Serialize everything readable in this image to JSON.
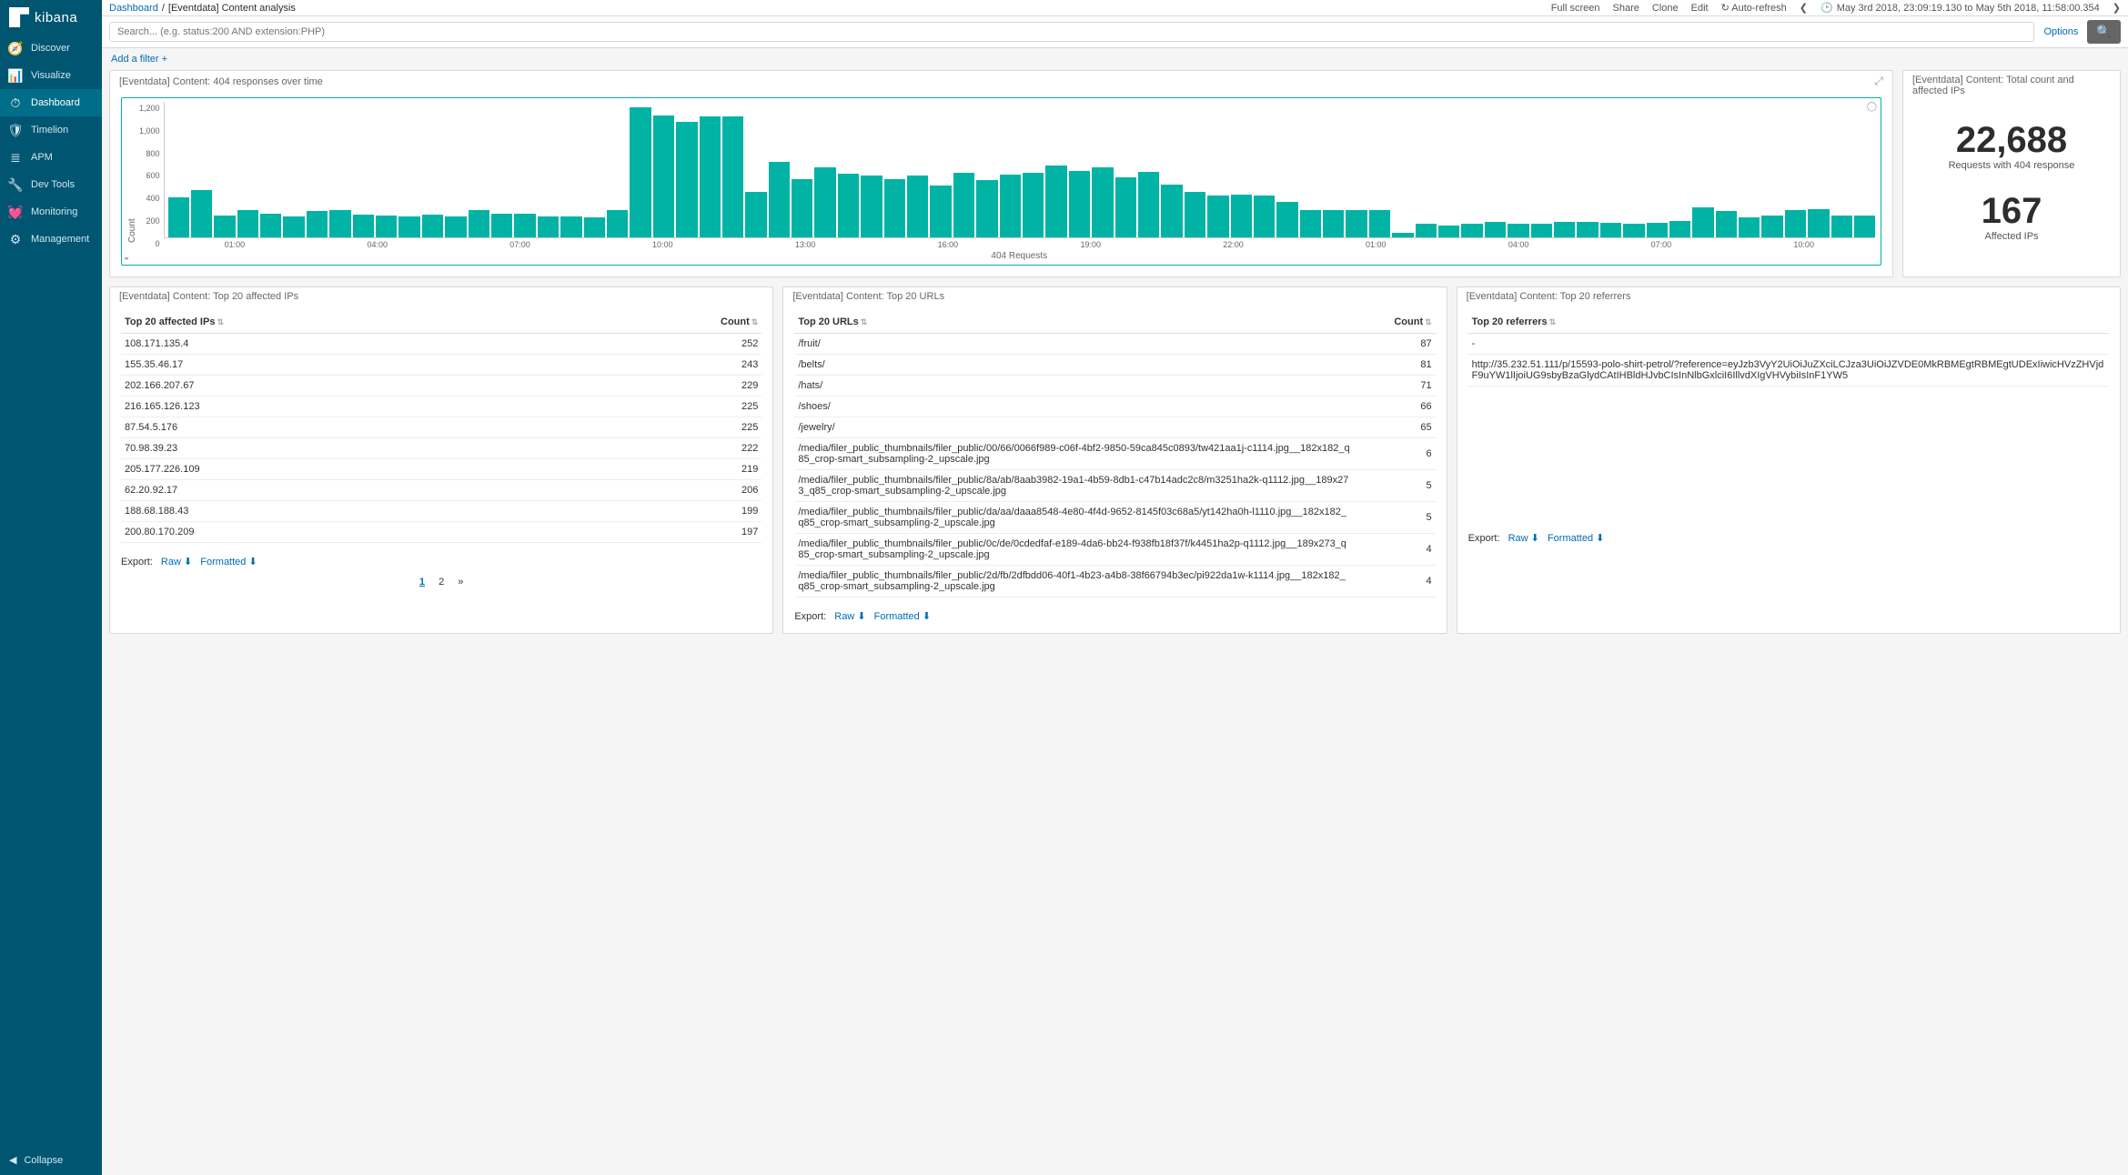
{
  "app": {
    "name": "kibana",
    "collapse_label": "Collapse"
  },
  "nav": {
    "items": [
      {
        "label": "Discover",
        "icon": "compass"
      },
      {
        "label": "Visualize",
        "icon": "bar-chart"
      },
      {
        "label": "Dashboard",
        "icon": "gauge",
        "active": true
      },
      {
        "label": "Timelion",
        "icon": "shield"
      },
      {
        "label": "APM",
        "icon": "list"
      },
      {
        "label": "Dev Tools",
        "icon": "wrench"
      },
      {
        "label": "Monitoring",
        "icon": "heartbeat"
      },
      {
        "label": "Management",
        "icon": "gear"
      }
    ]
  },
  "breadcrumb": {
    "root": "Dashboard",
    "sep": "/",
    "current": "[Eventdata] Content analysis"
  },
  "topbar": {
    "full_screen": "Full screen",
    "share": "Share",
    "clone": "Clone",
    "edit": "Edit",
    "auto_refresh": "Auto-refresh",
    "time_range": "May 3rd 2018, 23:09:19.130 to May 5th 2018, 11:58:00.354"
  },
  "search": {
    "placeholder": "Search... (e.g. status:200 AND extension:PHP)",
    "options_label": "Options"
  },
  "filter": {
    "add_label": "Add a filter"
  },
  "panels": {
    "chart_title": "[Eventdata] Content: 404 responses over time",
    "metrics_title": "[Eventdata] Content: Total count and affected IPs",
    "ips_title": "[Eventdata] Content: Top 20 affected IPs",
    "urls_title": "[Eventdata] Content: Top 20 URLs",
    "referrers_title": "[Eventdata] Content: Top 20 referrers"
  },
  "metrics": {
    "requests_value": "22,688",
    "requests_label": "Requests with 404 response",
    "ips_value": "167",
    "ips_label": "Affected IPs"
  },
  "export": {
    "label": "Export:",
    "raw": "Raw",
    "formatted": "Formatted"
  },
  "pagination": {
    "p1": "1",
    "p2": "2",
    "next": "»"
  },
  "ips_table": {
    "col_ip": "Top 20 affected IPs",
    "col_count": "Count",
    "rows": [
      {
        "ip": "108.171.135.4",
        "count": "252"
      },
      {
        "ip": "155.35.46.17",
        "count": "243"
      },
      {
        "ip": "202.166.207.67",
        "count": "229"
      },
      {
        "ip": "216.165.126.123",
        "count": "225"
      },
      {
        "ip": "87.54.5.176",
        "count": "225"
      },
      {
        "ip": "70.98.39.23",
        "count": "222"
      },
      {
        "ip": "205.177.226.109",
        "count": "219"
      },
      {
        "ip": "62.20.92.17",
        "count": "206"
      },
      {
        "ip": "188.68.188.43",
        "count": "199"
      },
      {
        "ip": "200.80.170.209",
        "count": "197"
      }
    ]
  },
  "urls_table": {
    "col_url": "Top 20 URLs",
    "col_count": "Count",
    "rows": [
      {
        "url": "/fruit/",
        "count": "87"
      },
      {
        "url": "/belts/",
        "count": "81"
      },
      {
        "url": "/hats/",
        "count": "71"
      },
      {
        "url": "/shoes/",
        "count": "66"
      },
      {
        "url": "/jewelry/",
        "count": "65"
      },
      {
        "url": "/media/filer_public_thumbnails/filer_public/00/66/0066f989-c06f-4bf2-9850-59ca845c0893/tw421aa1j-c1114.jpg__182x182_q85_crop-smart_subsampling-2_upscale.jpg",
        "count": "6"
      },
      {
        "url": "/media/filer_public_thumbnails/filer_public/8a/ab/8aab3982-19a1-4b59-8db1-c47b14adc2c8/m3251ha2k-q1112.jpg__189x273_q85_crop-smart_subsampling-2_upscale.jpg",
        "count": "5"
      },
      {
        "url": "/media/filer_public_thumbnails/filer_public/da/aa/daaa8548-4e80-4f4d-9652-8145f03c68a5/yt142ha0h-l1110.jpg__182x182_q85_crop-smart_subsampling-2_upscale.jpg",
        "count": "5"
      },
      {
        "url": "/media/filer_public_thumbnails/filer_public/0c/de/0cdedfaf-e189-4da6-bb24-f938fb18f37f/k4451ha2p-q1112.jpg__189x273_q85_crop-smart_subsampling-2_upscale.jpg",
        "count": "4"
      },
      {
        "url": "/media/filer_public_thumbnails/filer_public/2d/fb/2dfbdd06-40f1-4b23-a4b8-38f66794b3ec/pi922da1w-k1114.jpg__182x182_q85_crop-smart_subsampling-2_upscale.jpg",
        "count": "4"
      }
    ]
  },
  "referrers_table": {
    "col_ref": "Top 20 referrers",
    "rows": [
      {
        "ref": "-"
      },
      {
        "ref": "http://35.232.51.111/p/15593-polo-shirt-petrol/?reference=eyJzb3VyY2UiOiJuZXciLCJza3UiOiJZVDE0MkRBMEgtRBMEgtUDExIiwicHVzZHVjdF9uYW1lIjoiUG9sbyBzaGlydCAtIHBldHJvbCIsInNlbGxlciI6IllvdXIgVHVybiIsInF1YW5"
      }
    ]
  },
  "chart_data": {
    "type": "bar",
    "title": "",
    "xlabel": "404 Requests",
    "ylabel": "Count",
    "y_ticks": [
      "1,200",
      "1,000",
      "800",
      "600",
      "400",
      "200",
      "0"
    ],
    "x_ticks": [
      "01:00",
      "04:00",
      "07:00",
      "10:00",
      "13:00",
      "16:00",
      "19:00",
      "22:00",
      "01:00",
      "04:00",
      "07:00",
      "10:00"
    ],
    "ylim": [
      0,
      1300
    ],
    "series_color": "#00B3A4",
    "values": [
      380,
      450,
      210,
      260,
      230,
      200,
      250,
      260,
      220,
      210,
      200,
      220,
      200,
      260,
      230,
      230,
      200,
      200,
      190,
      260,
      1250,
      1170,
      1110,
      1160,
      1160,
      440,
      720,
      560,
      670,
      610,
      590,
      560,
      590,
      500,
      620,
      550,
      600,
      620,
      690,
      640,
      670,
      580,
      630,
      510,
      440,
      400,
      410,
      400,
      340,
      260,
      260,
      260,
      260,
      40,
      130,
      115,
      130,
      150,
      130,
      130,
      145,
      150,
      140,
      135,
      140,
      160,
      290,
      250,
      190,
      210,
      260,
      270,
      210,
      210
    ]
  }
}
